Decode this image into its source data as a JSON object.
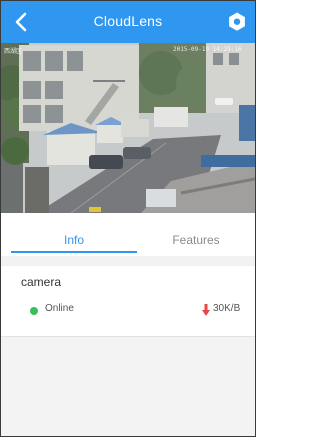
{
  "app": {
    "title": "CloudLens"
  },
  "header": {
    "back_icon": "chevron-left-icon",
    "settings_icon": "settings-icon",
    "accent_color": "#2f97f0"
  },
  "video": {
    "osd_left": "西湖区",
    "osd_right": "2015-09-19 14:29:16"
  },
  "tabs": [
    {
      "label": "Info",
      "active": true
    },
    {
      "label": "Features",
      "active": false
    }
  ],
  "device": {
    "name": "camera",
    "status": "Online",
    "status_color": "#35c25a",
    "rate": "30K/B",
    "rate_icon": "arrow-down-icon",
    "rate_icon_color": "#e84747"
  }
}
